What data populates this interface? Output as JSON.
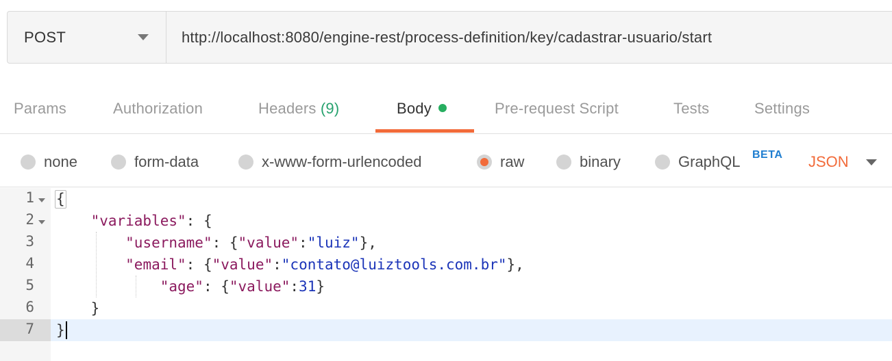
{
  "request": {
    "method": "POST",
    "url": "http://localhost:8080/engine-rest/process-definition/key/cadastrar-usuario/start"
  },
  "tabs": [
    {
      "label": "Params"
    },
    {
      "label": "Authorization"
    },
    {
      "label": "Headers",
      "count": "(9)"
    },
    {
      "label": "Body",
      "active": true
    },
    {
      "label": "Pre-request Script"
    },
    {
      "label": "Tests"
    },
    {
      "label": "Settings"
    }
  ],
  "body_options": {
    "none": "none",
    "form_data": "form-data",
    "urlencoded": "x-www-form-urlencoded",
    "raw": "raw",
    "binary": "binary",
    "graphql": "GraphQL",
    "beta_badge": "BETA",
    "selected": "raw",
    "format": "JSON"
  },
  "editor": {
    "line_numbers": [
      "1",
      "2",
      "3",
      "4",
      "5",
      "6",
      "7"
    ],
    "lines": {
      "l1": "{",
      "l2_key": "\"variables\"",
      "l2_rest": ": {",
      "l3_key": "\"username\"",
      "l3_a": ": {",
      "l3_k": "\"value\"",
      "l3_c": ":",
      "l3_v": "\"luiz\"",
      "l3_e": "},",
      "l4_key": "\"email\"",
      "l4_a": ": {",
      "l4_k": "\"value\"",
      "l4_c": ":",
      "l4_v": "\"contato@luiztools.com.br\"",
      "l4_e": "},",
      "l5_key": "\"age\"",
      "l5_a": ": {",
      "l5_k": "\"value\"",
      "l5_c": ":",
      "l5_v": "31",
      "l5_e": "}",
      "l6": "}",
      "l7": "}"
    },
    "active_line": 7
  },
  "colors": {
    "accent": "#f26b3a",
    "status_dot": "#27ae60",
    "json_key": "#8b1a5e",
    "json_string": "#1b34b8",
    "beta": "#1f7ed0"
  }
}
